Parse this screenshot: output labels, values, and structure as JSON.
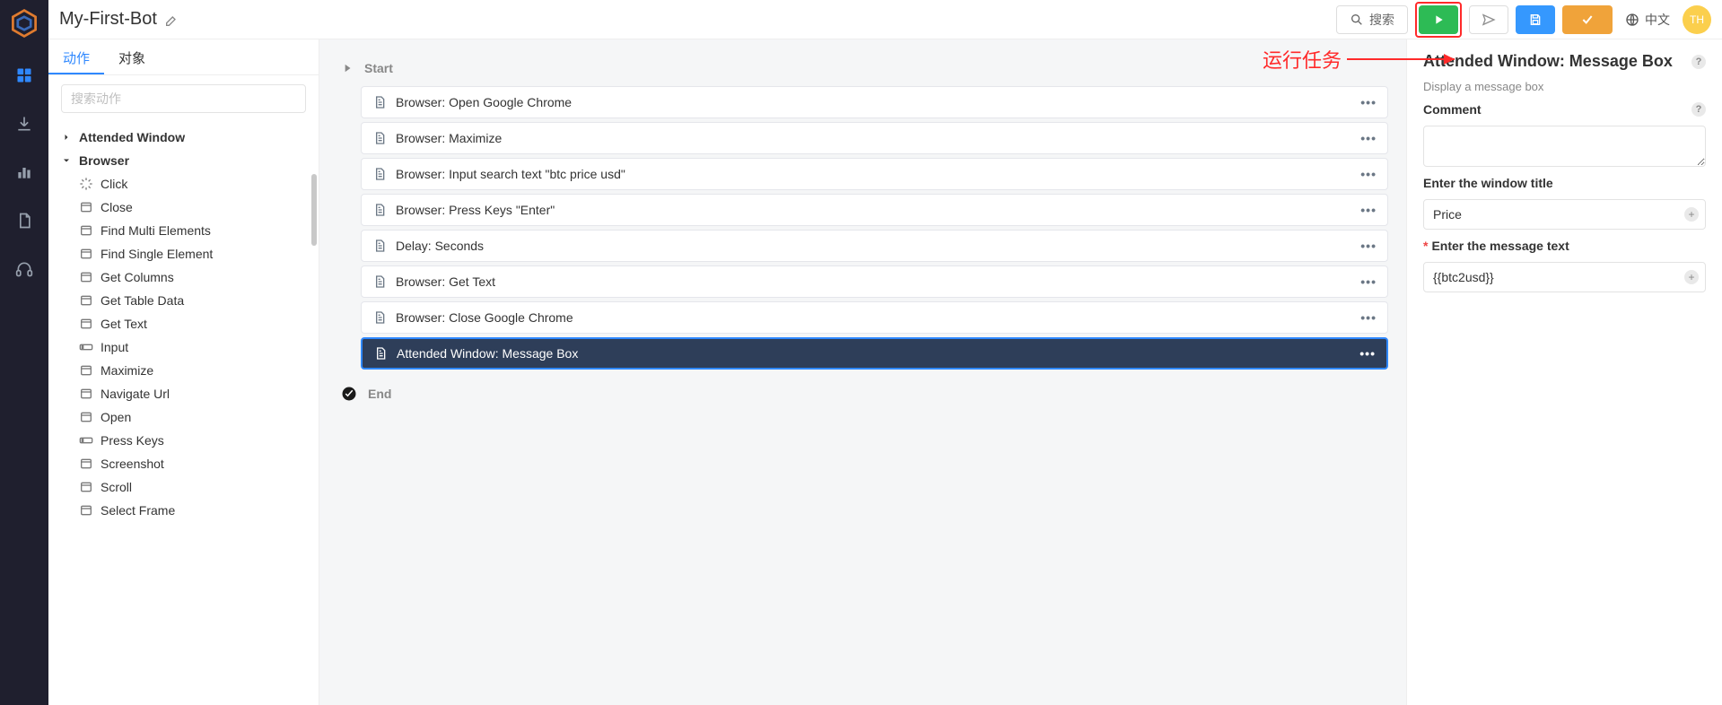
{
  "header": {
    "title": "My-First-Bot",
    "search_label": "搜索",
    "lang_label": "中文",
    "avatar_initials": "TH"
  },
  "annotation": {
    "run_task": "运行任务"
  },
  "side": {
    "tabs": {
      "actions": "动作",
      "objects": "对象"
    },
    "search_placeholder": "搜索动作",
    "groups": [
      {
        "name": "Attended Window",
        "expanded": false
      },
      {
        "name": "Browser",
        "expanded": true,
        "items": [
          "Click",
          "Close",
          "Find Multi Elements",
          "Find Single Element",
          "Get Columns",
          "Get Table Data",
          "Get Text",
          "Input",
          "Maximize",
          "Navigate Url",
          "Open",
          "Press Keys",
          "Screenshot",
          "Scroll",
          "Select Frame"
        ]
      }
    ]
  },
  "flow": {
    "start": "Start",
    "end": "End",
    "steps": [
      {
        "label": "Browser: Open Google Chrome",
        "selected": false
      },
      {
        "label": "Browser: Maximize",
        "selected": false
      },
      {
        "label": "Browser: Input search text \"btc price usd\"",
        "selected": false
      },
      {
        "label": "Browser: Press Keys \"Enter\"",
        "selected": false
      },
      {
        "label": "Delay: Seconds",
        "selected": false
      },
      {
        "label": "Browser: Get Text",
        "selected": false
      },
      {
        "label": "Browser: Close Google Chrome",
        "selected": false
      },
      {
        "label": "Attended Window: Message Box",
        "selected": true
      }
    ]
  },
  "props": {
    "title": "Attended Window: Message Box",
    "subtitle": "Display a message box",
    "comment_label": "Comment",
    "comment_value": "",
    "window_title_label": "Enter the window title",
    "window_title_value": "Price",
    "message_text_label": "Enter the message text",
    "message_text_value": "{{btc2usd}}"
  }
}
